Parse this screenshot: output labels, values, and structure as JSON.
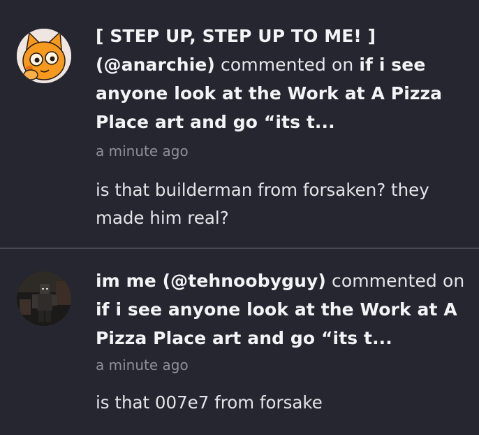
{
  "notifications": [
    {
      "username": "[ STEP UP, STEP UP TO ME! ] (@anarchie)",
      "action": "commented on",
      "post_title": "if i see anyone look at the Work at A Pizza Place art and go “its t...",
      "time": "a minute ago",
      "comment": "is that builderman from forsaken? they made him real?",
      "avatar_icon": "orange-cat-face-avatar"
    },
    {
      "username": "im me (@tehnoobyguy)",
      "action": "commented on",
      "post_title": "if i see anyone look at the Work at A Pizza Place art and go “its t...",
      "time": "a minute ago",
      "comment": "is that  007e7 from forsake",
      "avatar_icon": "dark-roblox-figure-avatar"
    }
  ],
  "colors": {
    "background": "#262631",
    "divider": "#4a4a57",
    "primary_text": "#f1f1f4",
    "muted_text": "#8f8f9a",
    "avatar_orange": "#f59a1e"
  }
}
